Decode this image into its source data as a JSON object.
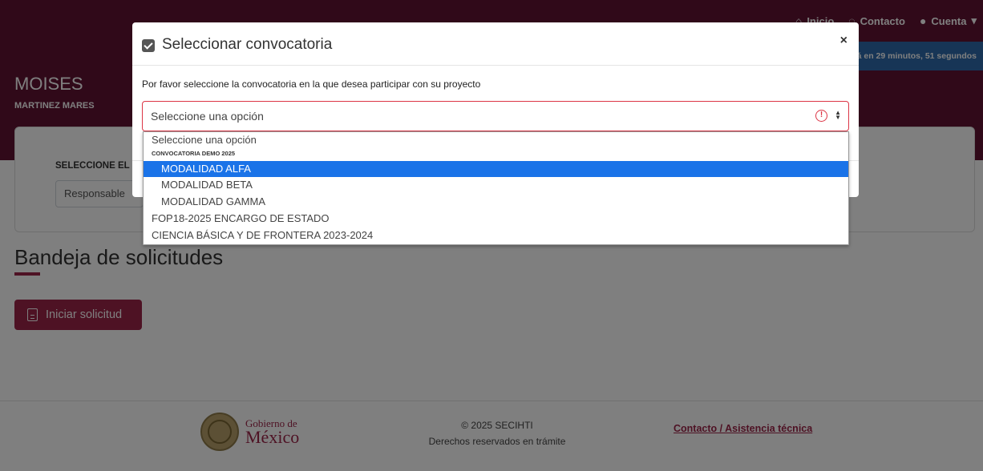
{
  "nav": {
    "home": "Inicio",
    "contact": "Contacto",
    "account": "Cuenta"
  },
  "session_timer": "á en 29 minutos, 51 segundos",
  "user": {
    "name": "MOISES",
    "surname": "MARTINEZ MARES"
  },
  "role": {
    "label": "SELECCIONE EL RO",
    "value": "Responsable"
  },
  "main": {
    "title": "Bandeja de solicitudes",
    "start_button": "Iniciar solicitud"
  },
  "footer": {
    "gov_line1": "Gobierno de",
    "gov_line2": "México",
    "copyright": "© 2025 SECIHTI",
    "rights": "Derechos reservados en trámite",
    "contact_link": "Contacto / Asistencia técnica"
  },
  "modal": {
    "title": "Seleccionar convocatoria",
    "close": "×",
    "instruction": "Por favor seleccione la convocatoria en la que desea participar con su proyecto",
    "select_value": "Seleccione una opción"
  },
  "dropdown": {
    "placeholder": "Seleccione una opción",
    "group": "CONVOCATORIA DEMO 2025",
    "group_options": [
      "MODALIDAD ALFA",
      "MODALIDAD BETA",
      "MODALIDAD GAMMA"
    ],
    "options": [
      "FOP18-2025 ENCARGO DE ESTADO",
      "CIENCIA BÁSICA Y DE FRONTERA 2023-2024"
    ],
    "selected": "MODALIDAD ALFA"
  },
  "colors": {
    "brand": "#611232",
    "accent": "#9d2449",
    "timer": "#2f6bad",
    "highlight": "#1a73e8",
    "error": "#dc3545"
  }
}
